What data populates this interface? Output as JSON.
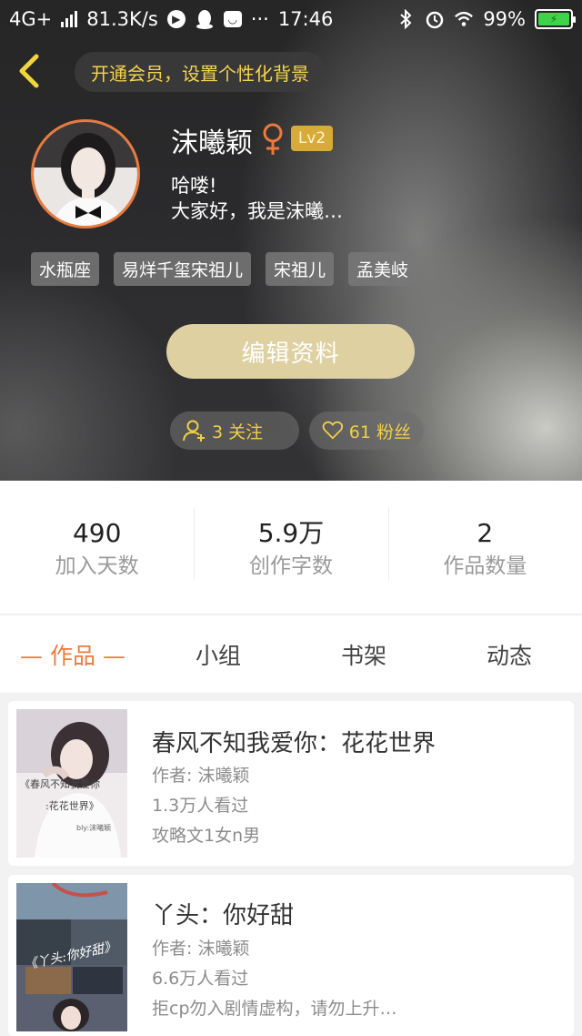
{
  "status_bar": {
    "network": "4G+",
    "speed": "81.3K/s",
    "dots": "···",
    "time": "17:46",
    "battery": "99%"
  },
  "header": {
    "vip_banner": "开通会员，设置个性化背景",
    "username": "沫曦颖",
    "level": "Lv2",
    "bio_line1": "哈喽!",
    "bio_line2": "大家好，我是沫曦…",
    "tags": [
      "水瓶座",
      "易烊千玺宋祖儿",
      "宋祖儿",
      "孟美岐"
    ],
    "edit_label": "编辑资料",
    "follow_label": "3 关注",
    "fans_label": "61 粉丝"
  },
  "stats": [
    {
      "value": "490",
      "label": "加入天数"
    },
    {
      "value": "5.9万",
      "label": "创作字数"
    },
    {
      "value": "2",
      "label": "作品数量"
    }
  ],
  "tabs": [
    "— 作品 —",
    "小组",
    "书架",
    "动态"
  ],
  "works": [
    {
      "title": "春风不知我爱你：花花世界",
      "author": "作者: 沫曦颖",
      "views": "1.3万人看过",
      "desc": "攻略文1女n男",
      "cover_text1": "《春风不知我爱你",
      "cover_text2": ":花花世界》",
      "cover_text3": "bly:沫曦颖"
    },
    {
      "title": "丫头：你好甜",
      "author": "作者: 沫曦颖",
      "views": "6.6万人看过",
      "desc": "拒cp勿入剧情虚构，请勿上升…",
      "cover_text1": "《丫头:你好甜》"
    }
  ],
  "colors": {
    "accent_orange": "#f07a3a",
    "gold": "#f0cf47",
    "edit_button": "#ded0a1",
    "level_badge": "#d8aa3a"
  }
}
